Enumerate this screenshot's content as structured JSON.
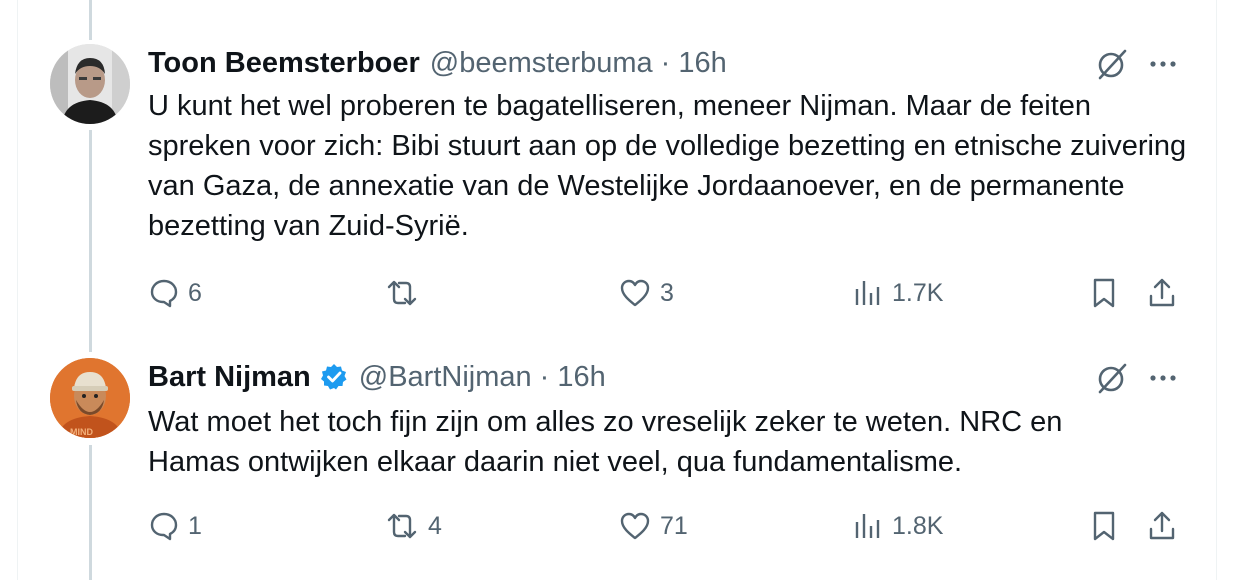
{
  "colors": {
    "text": "#0f1419",
    "secondary": "#536471",
    "thread_line": "#cfd9de",
    "verified": "#1d9bf0"
  },
  "tweets": [
    {
      "author": "Toon Beemsterboer",
      "handle": "@beemsterbuma",
      "separator": "·",
      "time": "16h",
      "verified": false,
      "text": "U kunt het wel proberen te bagatelliseren, meneer Nijman. Maar de feiten spreken voor zich: Bibi stuurt aan op de volledige bezetting en etnische zuivering van Gaza, de annexatie van de Westelijke Jordaanoever, en de permanente bezetting van Zuid-Syrië.",
      "stats": {
        "replies": "6",
        "reposts": "",
        "likes": "3",
        "views": "1.7K"
      }
    },
    {
      "author": "Bart Nijman",
      "handle": "@BartNijman",
      "separator": "·",
      "time": "16h",
      "verified": true,
      "text": "Wat moet het toch fijn zijn om alles zo vreselijk zeker te weten. NRC en Hamas ontwijken elkaar daarin niet veel, qua fundamentalisme.",
      "stats": {
        "replies": "1",
        "reposts": "4",
        "likes": "71",
        "views": "1.8K"
      }
    }
  ],
  "icons": {
    "reply": "reply-icon",
    "repost": "repost-icon",
    "like": "like-icon",
    "views": "views-icon",
    "bookmark": "bookmark-icon",
    "share": "share-icon",
    "grok": "grok-icon",
    "more": "more-icon",
    "verified": "verified-badge-icon"
  }
}
